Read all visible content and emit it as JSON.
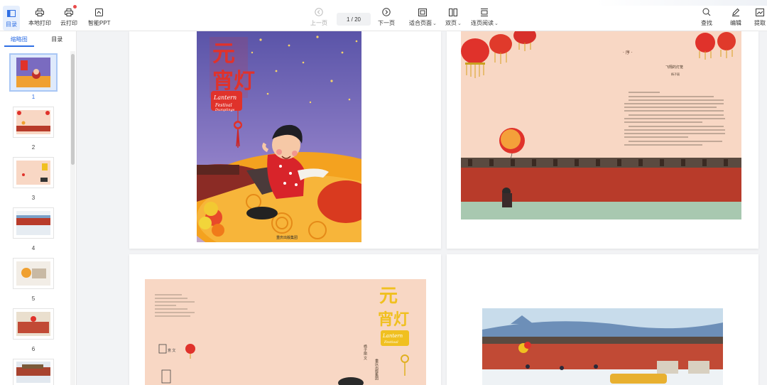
{
  "toolbar": {
    "contents": "目录",
    "local_print": "本地打印",
    "cloud_print": "云打印",
    "smart_ppt": "智能PPT",
    "prev_page": "上一页",
    "page_indicator": "1 / 20",
    "next_page": "下一页",
    "fit_page": "适合页面",
    "dual_page": "双页",
    "continuous_read": "连页阅读",
    "find": "查找",
    "edit": "编辑",
    "extract": "提取"
  },
  "sidebar": {
    "tabs": [
      "缩略图",
      "目录"
    ],
    "thumbnails": [
      "1",
      "2",
      "3",
      "4",
      "5",
      "6"
    ]
  },
  "document": {
    "cover_title": "元宵灯",
    "cover_english": "Lantern Festival",
    "page2_section": "序",
    "page2_heading": "飞翔的灯笼",
    "back_title": "元宵灯"
  },
  "colors": {
    "accent": "#2f6fe4",
    "cover_purple": "#6f63b8",
    "lantern_red": "#e0322b",
    "peach": "#f7d2bd",
    "wall_red": "#b83b2a"
  }
}
